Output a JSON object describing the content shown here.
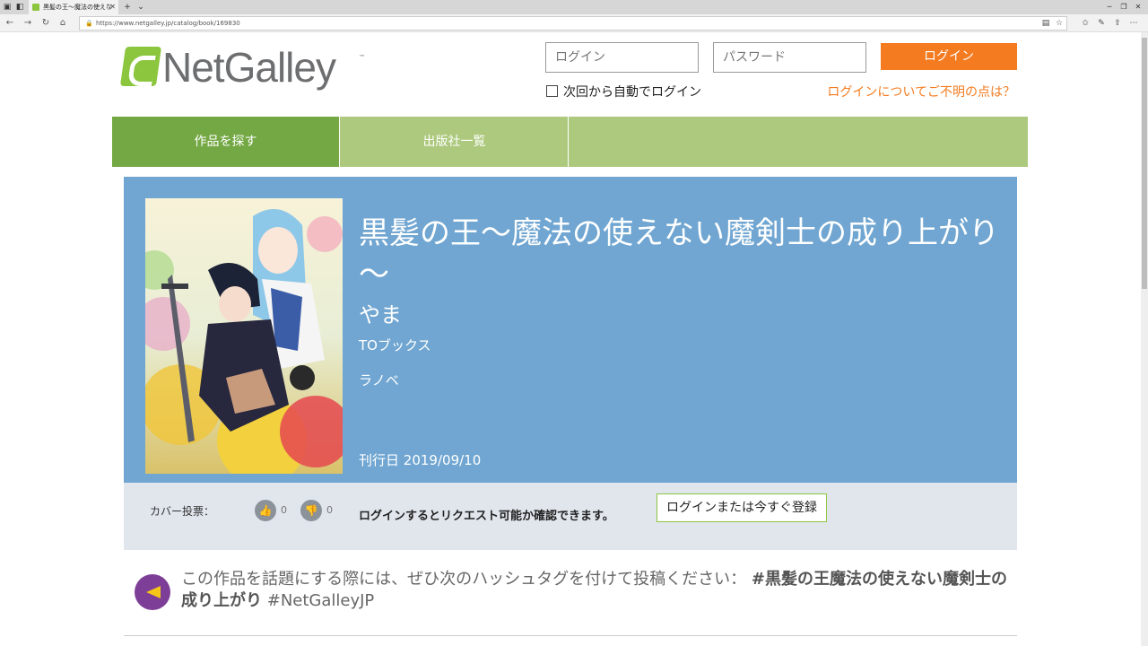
{
  "browser": {
    "tab_title": "黒髪の王～魔法の使えな",
    "url": "https://www.netgalley.jp/catalog/book/169830"
  },
  "header": {
    "logo_text": "NetGalley",
    "logo_tm": "™",
    "login_placeholder": "ログイン",
    "password_placeholder": "パスワード",
    "login_button": "ログイン",
    "remember_label": "次回から自動でログイン",
    "login_help": "ログインについてご不明の点は？"
  },
  "nav": {
    "items": [
      {
        "label": "作品を探す"
      },
      {
        "label": "出版社一覧"
      },
      {
        "label": ""
      }
    ]
  },
  "book": {
    "title": "黒髪の王～魔法の使えない魔剣士の成り上がり～",
    "author": "やま",
    "publisher": "TOブックス",
    "genre": "ラノベ",
    "date_label": "刊行日",
    "date": "2019/09/10"
  },
  "votes": {
    "label": "カバー投票：",
    "up_count": "0",
    "down_count": "0",
    "message": "ログインするとリクエスト可能か確認できます。",
    "button": "ログインまたは今すぐ登録"
  },
  "hashtag": {
    "prefix": "この作品を話題にする際には、ぜひ次のハッシュタグを付けて投稿ください：",
    "tag1": "#黒髪の王魔法の使えない魔剣士の成り上がり",
    "tag2": "#NetGalleyJP"
  },
  "colors": {
    "brand_green": "#8cc63f",
    "nav_active": "#74a844",
    "nav_bg": "#adc97e",
    "book_bg": "#70a6d1",
    "accent_orange": "#f47b20",
    "hashtag_icon": "#7d3e97"
  }
}
